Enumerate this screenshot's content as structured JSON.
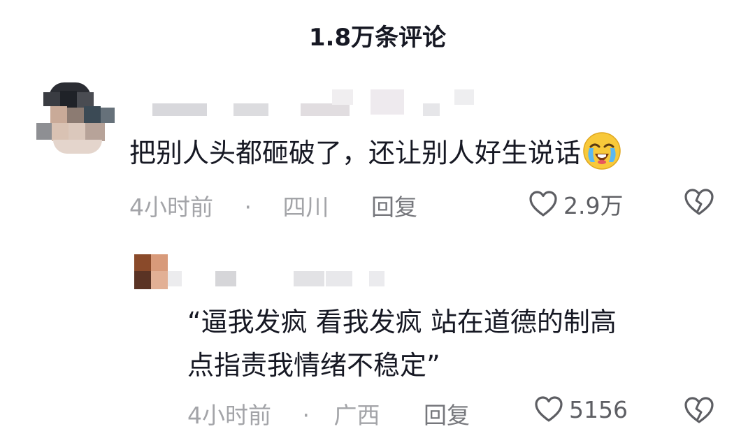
{
  "header": {
    "title": "1.8万条评论"
  },
  "comments": [
    {
      "text": "把别人头都砸破了，还让别人好生说话",
      "emoji": "loudly-crying-face-emoji",
      "time": "4小时前",
      "dot": "·",
      "location": "四川",
      "reply_label": "回复",
      "likes": "2.9万"
    },
    {
      "text_line1": "“逼我发疯  看我发疯  站在道德的制高",
      "text_line2": "点指责我情绪不稳定”",
      "time": "4小时前",
      "dot": "·",
      "location": "广西",
      "reply_label": "回复",
      "likes": "5156"
    }
  ],
  "icons": {
    "like": "heart-outline-icon",
    "dislike": "broken-heart-icon"
  },
  "colors": {
    "text": "#161823",
    "meta": "#a3a4a8",
    "like_count": "#5d5e63"
  }
}
